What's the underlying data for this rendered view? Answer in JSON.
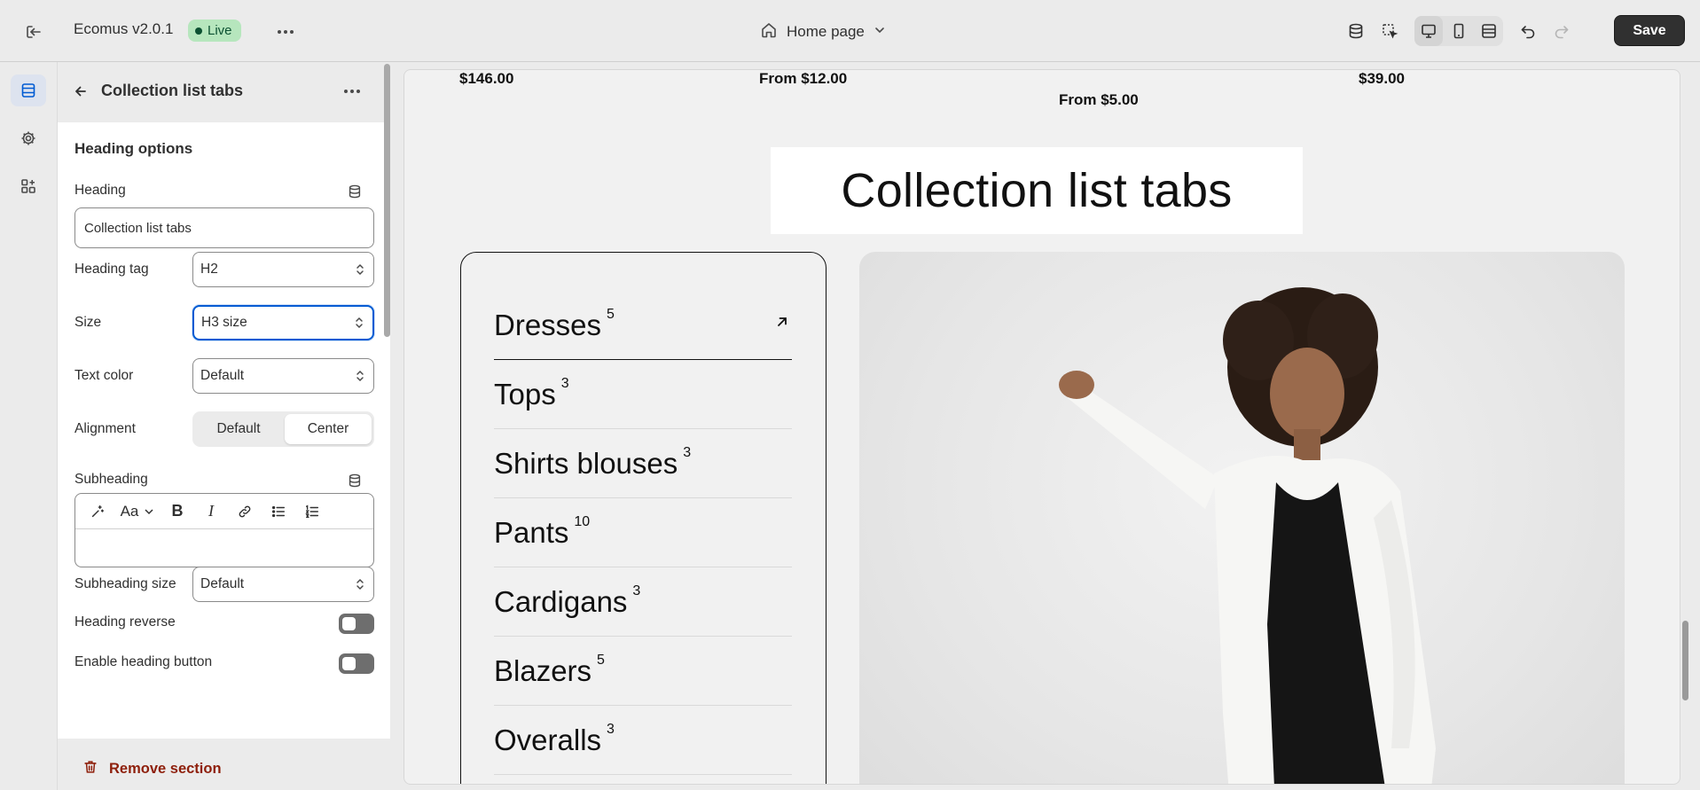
{
  "topbar": {
    "theme_name": "Ecomus v2.0.1",
    "live_badge": "Live",
    "page_selector": "Home page",
    "save_label": "Save"
  },
  "panel": {
    "title": "Collection list tabs",
    "section_title": "Heading options",
    "heading_label": "Heading",
    "heading_value": "Collection list tabs",
    "heading_tag_label": "Heading tag",
    "heading_tag_value": "H2",
    "size_label": "Size",
    "size_value": "H3 size",
    "text_color_label": "Text color",
    "text_color_value": "Default",
    "alignment_label": "Alignment",
    "alignment_options": [
      "Default",
      "Center"
    ],
    "alignment_selected": "Center",
    "subheading_label": "Subheading",
    "subheading_value": "",
    "subheading_size_label": "Subheading size",
    "subheading_size_value": "Default",
    "heading_reverse_label": "Heading reverse",
    "heading_reverse_on": false,
    "enable_heading_button_label": "Enable heading button",
    "enable_heading_button_on": false,
    "remove_section_label": "Remove section"
  },
  "preview": {
    "prices": [
      "$146.00",
      "From $12.00",
      "From $5.00",
      "$39.00"
    ],
    "section_heading": "Collection list tabs",
    "tabs": [
      {
        "name": "Dresses",
        "count": "5"
      },
      {
        "name": "Tops",
        "count": "3"
      },
      {
        "name": "Shirts blouses",
        "count": "3"
      },
      {
        "name": "Pants",
        "count": "10"
      },
      {
        "name": "Cardigans",
        "count": "3"
      },
      {
        "name": "Blazers",
        "count": "5"
      },
      {
        "name": "Overalls",
        "count": "3"
      }
    ]
  },
  "colors": {
    "accent_focus": "#005bd3",
    "live_bg": "#b6e6bd",
    "danger": "#8e1f0b",
    "save_bg": "#303030"
  }
}
